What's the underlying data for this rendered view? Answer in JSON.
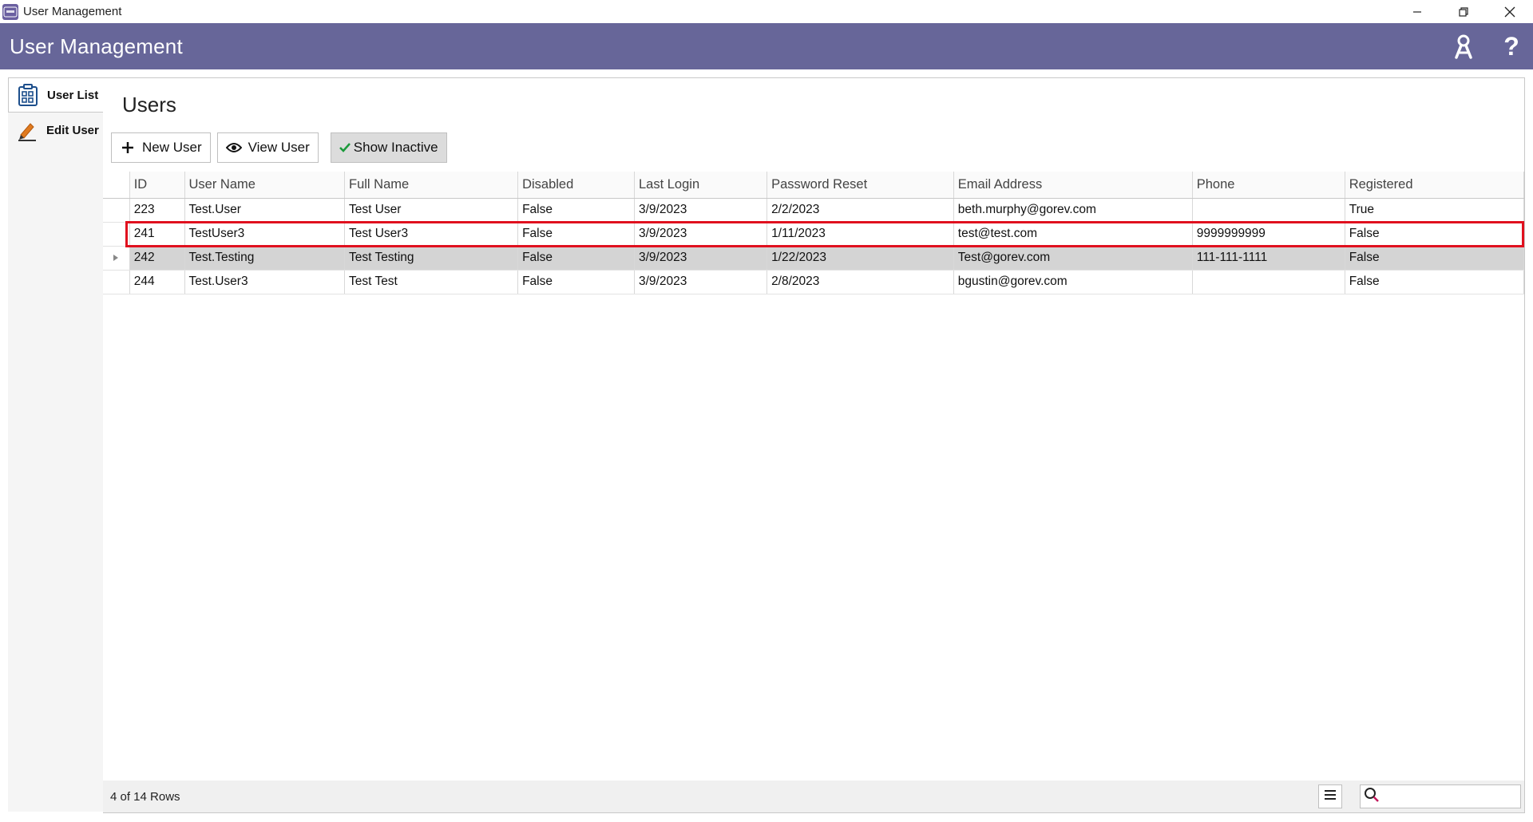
{
  "window": {
    "title": "User Management",
    "app_icon_text": "User",
    "minimize_glyph": "—",
    "restore_glyph": "❐",
    "close_glyph": "✕"
  },
  "header": {
    "title": "User Management",
    "icons": [
      "users-key-icon",
      "help-icon"
    ],
    "help_glyph": "?",
    "accent_color": "#676699"
  },
  "sidebar": {
    "items": [
      {
        "label": "User List",
        "icon": "clipboard-grid-icon",
        "active": true
      },
      {
        "label": "Edit User",
        "icon": "pencil-icon",
        "active": false
      }
    ]
  },
  "page": {
    "title": "Users"
  },
  "toolbar": {
    "new_user_label": "New User",
    "view_user_label": "View User",
    "show_inactive_label": "Show Inactive",
    "show_inactive_checked": true
  },
  "grid": {
    "columns": [
      "ID",
      "User Name",
      "Full Name",
      "Disabled",
      "Last Login",
      "Password Reset",
      "Email Address",
      "Phone",
      "Registered"
    ],
    "rows": [
      {
        "id": "223",
        "user_name": "Test.User",
        "full_name": "Test User",
        "disabled": "False",
        "last_login": "3/9/2023",
        "password_reset": "2/2/2023",
        "email": "beth.murphy@gorev.com",
        "phone": "",
        "registered": "True"
      },
      {
        "id": "241",
        "user_name": "TestUser3",
        "full_name": "Test User3",
        "disabled": "False",
        "last_login": "3/9/2023",
        "password_reset": "1/11/2023",
        "email": "test@test.com",
        "phone": "9999999999",
        "registered": "False"
      },
      {
        "id": "242",
        "user_name": "Test.Testing",
        "full_name": "Test Testing",
        "disabled": "False",
        "last_login": "3/9/2023",
        "password_reset": "1/22/2023",
        "email": "Test@gorev.com",
        "phone": "111-111-1111",
        "registered": "False"
      },
      {
        "id": "244",
        "user_name": "Test.User3",
        "full_name": "Test Test",
        "disabled": "False",
        "last_login": "3/9/2023",
        "password_reset": "2/8/2023",
        "email": "bgustin@gorev.com",
        "phone": "",
        "registered": "False"
      }
    ],
    "selected_index": 2,
    "selection_highlight_color": "#e0101e"
  },
  "footer": {
    "row_count": "4 of 14 Rows",
    "search_value": "",
    "search_placeholder": ""
  }
}
